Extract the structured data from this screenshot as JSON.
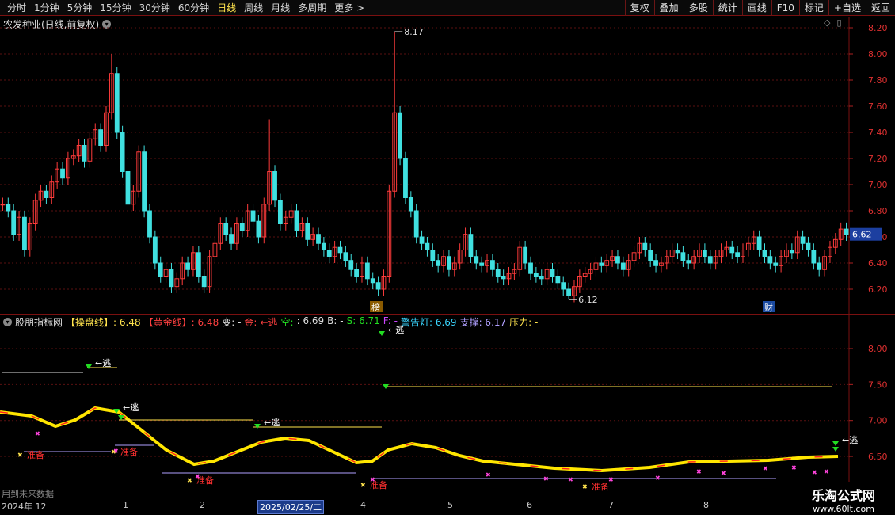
{
  "toolbar": {
    "periods": [
      "分时",
      "1分钟",
      "5分钟",
      "15分钟",
      "30分钟",
      "60分钟",
      "日线",
      "周线",
      "月线",
      "多周期",
      "更多 >"
    ],
    "active_period": "日线",
    "buttons": [
      "复权",
      "叠加",
      "多股",
      "统计",
      "画线",
      "F10",
      "标记",
      "+自选",
      "返回"
    ]
  },
  "main_chart": {
    "title": "农发种业(日线,前复权)",
    "price_axis": [
      "8.20",
      "8.00",
      "7.80",
      "7.60",
      "7.40",
      "7.20",
      "7.00",
      "6.80",
      "6.60",
      "6.40",
      "6.20"
    ],
    "current_price": "6.62",
    "high_label": "8.17",
    "low_label": "6.12",
    "badge_bang": "榜",
    "badge_cai": "财"
  },
  "indicator": {
    "name": "股朋指标网",
    "fields": [
      {
        "label": "【操盘线】",
        "value": ": 6.48",
        "label_color": "#ffe34d",
        "value_color": "#ffe34d"
      },
      {
        "label": "【黄金线】",
        "value": ": 6.48",
        "label_color": "#ff4040",
        "value_color": "#ff4040"
      },
      {
        "label": "变",
        "value": ": -",
        "label_color": "#dddddd",
        "value_color": "#dddddd"
      },
      {
        "label": "金",
        "value": ": ",
        "label_color": "#ff4040",
        "value_color": "#ff4040"
      },
      {
        "label": "←逃",
        "value": "",
        "label_color": "#ff4040",
        "value_color": "#ff4040"
      },
      {
        "label": "空",
        "value": ": ",
        "label_color": "#22dd22",
        "value_color": "#22dd22"
      },
      {
        "label": "",
        "value": ": 6.69",
        "label_color": "#dddddd",
        "value_color": "#dddddd"
      },
      {
        "label": "B",
        "value": ": -",
        "label_color": "#dddddd",
        "value_color": "#dddddd"
      },
      {
        "label": "S",
        "value": ": 6.71",
        "label_color": "#22dd22",
        "value_color": "#22dd22"
      },
      {
        "label": "F",
        "value": ": -",
        "label_color": "#cc44ff",
        "value_color": "#cc44ff"
      },
      {
        "label": "警告灯",
        "value": ": 6.69",
        "label_color": "#3ad6ff",
        "value_color": "#3ad6ff"
      },
      {
        "label": "支撑",
        "value": ": 6.17",
        "label_color": "#b0a0ff",
        "value_color": "#b0a0ff"
      },
      {
        "label": "压力",
        "value": ": -",
        "label_color": "#ffe34d",
        "value_color": "#ffe34d"
      }
    ],
    "axis": [
      "8.00",
      "7.50",
      "7.00",
      "6.50"
    ],
    "label_escape": "←逃",
    "label_prepare": "准备"
  },
  "watermark": "用到未来数据",
  "date_axis": [
    "2024年 12",
    "1",
    "2",
    "2025/02/25/二",
    "4",
    "5",
    "6",
    "7",
    "8"
  ],
  "logo": {
    "cn": "乐淘公式网",
    "url": "www.60lt.com"
  },
  "colors": {
    "up": "#ff3b3b",
    "down": "#40e0e0",
    "grid": "#5a1010",
    "yellow_line": "#ffe600",
    "red_line": "#ff2020"
  }
}
